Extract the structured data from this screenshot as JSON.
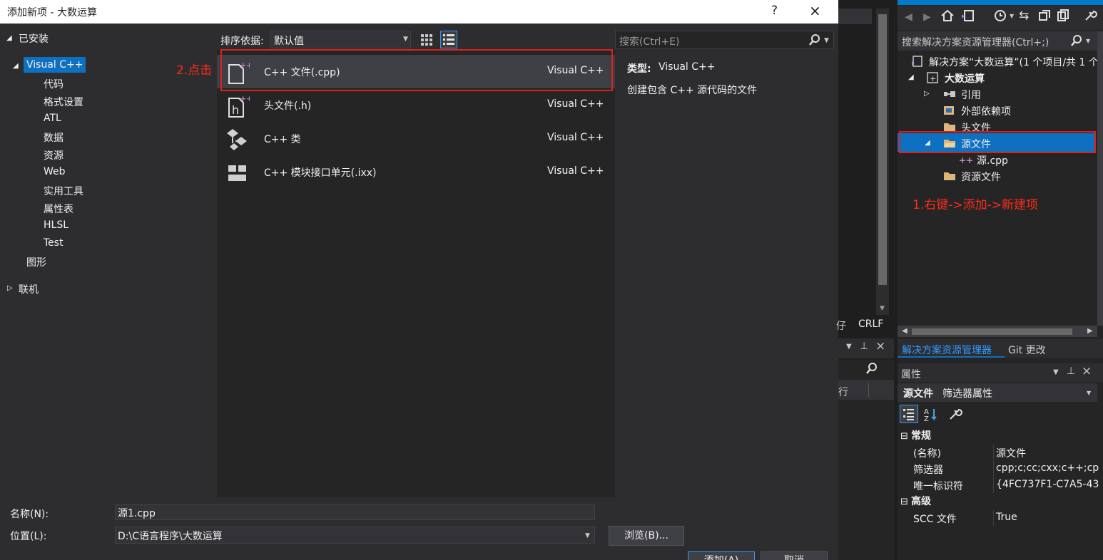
{
  "dialog": {
    "title": "添加新项 - 大数运算",
    "help_glyph": "?",
    "close_glyph": "×",
    "left_tree": {
      "installed": "已安装",
      "visual_cpp": "Visual C++",
      "children": [
        "代码",
        "格式设置",
        "ATL",
        "数据",
        "资源",
        "Web",
        "实用工具",
        "属性表",
        "HLSL",
        "Test"
      ],
      "graphics": "图形",
      "online": "联机"
    },
    "toolbar": {
      "sort_label": "排序依据:",
      "sort_value": "默认值",
      "search_placeholder": "搜索(Ctrl+E)"
    },
    "templates": [
      {
        "name": "C++ 文件(.cpp)",
        "type": "Visual C++"
      },
      {
        "name": "头文件(.h)",
        "type": "Visual C++"
      },
      {
        "name": "C++ 类",
        "type": "Visual C++"
      },
      {
        "name": "C++ 模块接口单元(.ixx)",
        "type": "Visual C++"
      }
    ],
    "details": {
      "type_label": "类型:",
      "type_value": "Visual C++",
      "description": "创建包含 C++ 源代码的文件"
    },
    "bottom": {
      "name_label": "名称(N):",
      "name_value": "源1.cpp",
      "location_label": "位置(L):",
      "location_value": "D:\\C语言程序\\大数运算",
      "browse_label": "浏览(B)...",
      "add_label": "添加(A)",
      "cancel_label": "取消"
    }
  },
  "middle": {
    "line_ending": "CRLF",
    "fragment_left": "仔",
    "fragment_col": "行"
  },
  "solution_explorer": {
    "search_placeholder": "搜索解决方案资源管理器(Ctrl+;)",
    "tree": {
      "solution": "解决方案“大数运算”(1 个项目/共 1 个",
      "project": "大数运算",
      "references": "引用",
      "external_deps": "外部依赖项",
      "header_files": "头文件",
      "source_files": "源文件",
      "source_cpp": "源.cpp",
      "resource_files": "资源文件"
    },
    "tabs": [
      "解决方案资源管理器",
      "Git 更改"
    ]
  },
  "properties": {
    "title": "属性",
    "selected": "源文件",
    "selected_type": "筛选器属性",
    "category_general": "常规",
    "category_advanced": "高级",
    "rows": [
      {
        "key": "(名称)",
        "value": "源文件"
      },
      {
        "key": "筛选器",
        "value": "cpp;c;cc;cxx;c++;cp"
      },
      {
        "key": "唯一标识符",
        "value": "{4FC737F1-C7A5-43"
      }
    ],
    "advanced_rows": [
      {
        "key": "SCC 文件",
        "value": "True"
      }
    ]
  },
  "annotations": {
    "step1": "1.右键->添加->新建项",
    "step2": "2.点击"
  },
  "colors": {
    "accent": "#0e70c0",
    "annotation": "#e0201a",
    "dialog_bg": "#2d2d30",
    "list_bg": "#252526"
  }
}
